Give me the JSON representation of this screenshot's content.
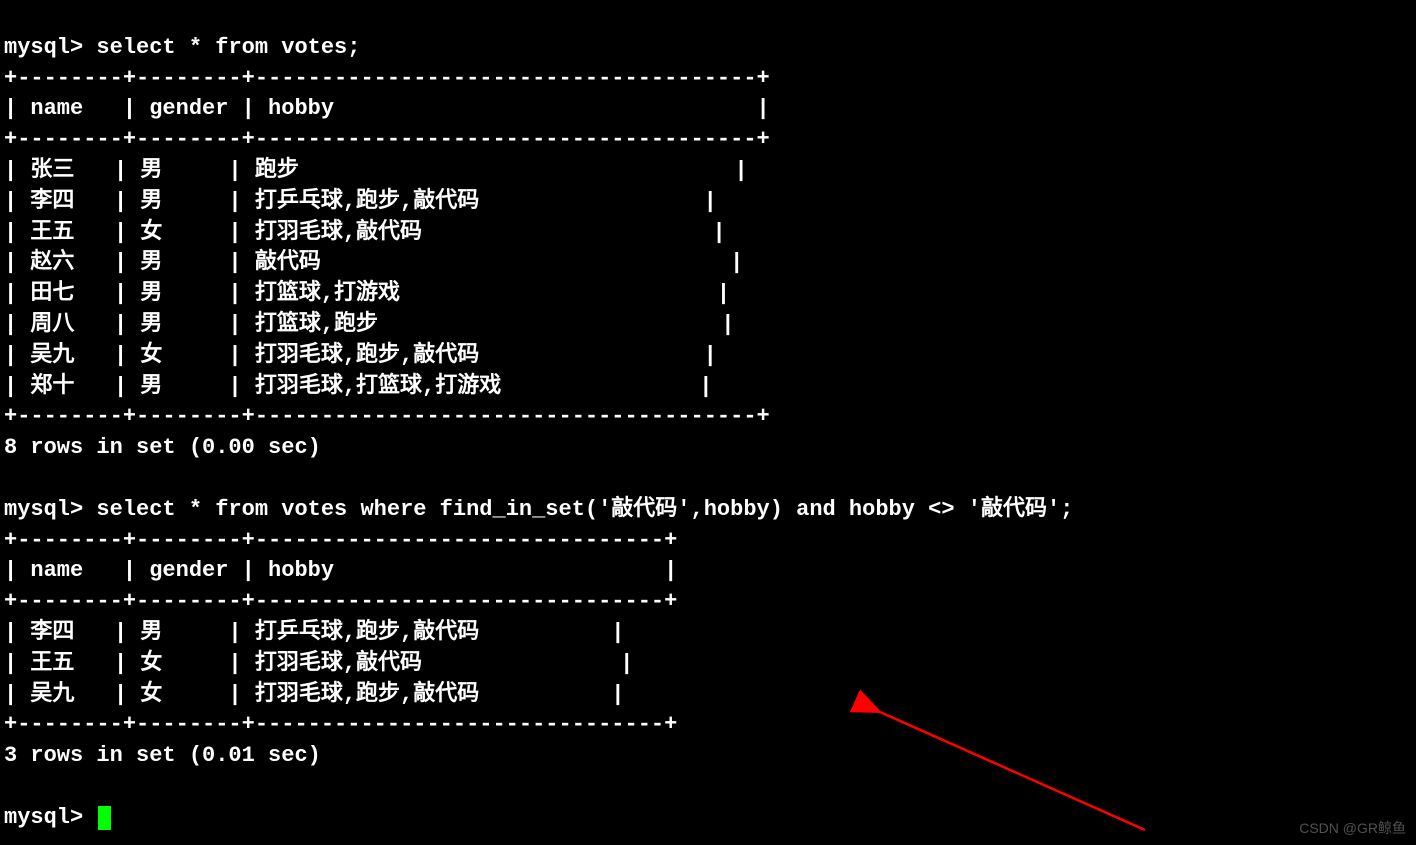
{
  "prompt": "mysql>",
  "queries": {
    "q1": "select * from votes;",
    "q2": "select * from votes where find_in_set('敲代码',hobby) and hobby <> '敲代码';"
  },
  "tables": {
    "t1": {
      "border_top": "+--------+--------+--------------------------------------+",
      "border_mid": "+--------+--------+--------------------------------------+",
      "border_bot": "+--------+--------+--------------------------------------+",
      "header": "| name   | gender | hobby                                |",
      "rows": [
        "| 张三   | 男     | 跑步                                 |",
        "| 李四   | 男     | 打乒乓球,跑步,敲代码                 |",
        "| 王五   | 女     | 打羽毛球,敲代码                      |",
        "| 赵六   | 男     | 敲代码                               |",
        "| 田七   | 男     | 打篮球,打游戏                        |",
        "| 周八   | 男     | 打篮球,跑步                          |",
        "| 吴九   | 女     | 打羽毛球,跑步,敲代码                 |",
        "| 郑十   | 男     | 打羽毛球,打篮球,打游戏               |"
      ],
      "summary": "8 rows in set (0.00 sec)"
    },
    "t2": {
      "border_top": "+--------+--------+-------------------------------+",
      "border_mid": "+--------+--------+-------------------------------+",
      "border_bot": "+--------+--------+-------------------------------+",
      "header": "| name   | gender | hobby                         |",
      "rows": [
        "| 李四   | 男     | 打乒乓球,跑步,敲代码          |",
        "| 王五   | 女     | 打羽毛球,敲代码               |",
        "| 吴九   | 女     | 打羽毛球,跑步,敲代码          |"
      ],
      "summary": "3 rows in set (0.01 sec)"
    }
  },
  "watermark": "CSDN @GR鲸鱼",
  "chart_data": {
    "type": "table",
    "tables": [
      {
        "query": "select * from votes;",
        "columns": [
          "name",
          "gender",
          "hobby"
        ],
        "rows": [
          [
            "张三",
            "男",
            "跑步"
          ],
          [
            "李四",
            "男",
            "打乒乓球,跑步,敲代码"
          ],
          [
            "王五",
            "女",
            "打羽毛球,敲代码"
          ],
          [
            "赵六",
            "男",
            "敲代码"
          ],
          [
            "田七",
            "男",
            "打篮球,打游戏"
          ],
          [
            "周八",
            "男",
            "打篮球,跑步"
          ],
          [
            "吴九",
            "女",
            "打羽毛球,跑步,敲代码"
          ],
          [
            "郑十",
            "男",
            "打羽毛球,打篮球,打游戏"
          ]
        ],
        "row_count": 8,
        "duration_sec": 0.0
      },
      {
        "query": "select * from votes where find_in_set('敲代码',hobby) and hobby <> '敲代码';",
        "columns": [
          "name",
          "gender",
          "hobby"
        ],
        "rows": [
          [
            "李四",
            "男",
            "打乒乓球,跑步,敲代码"
          ],
          [
            "王五",
            "女",
            "打羽毛球,敲代码"
          ],
          [
            "吴九",
            "女",
            "打羽毛球,跑步,敲代码"
          ]
        ],
        "row_count": 3,
        "duration_sec": 0.01
      }
    ]
  }
}
